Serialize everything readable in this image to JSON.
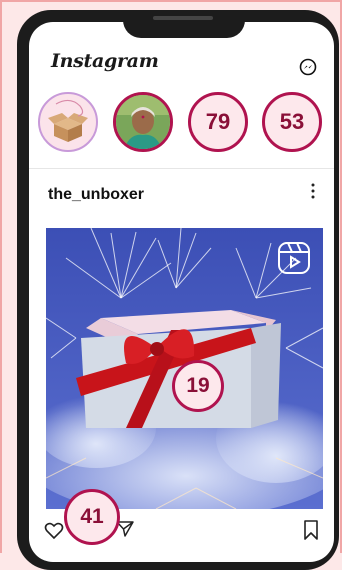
{
  "header": {
    "brand": "Instagram",
    "messenger_icon": "messenger-icon"
  },
  "stories": [
    {
      "type": "own",
      "icon": "box-icon"
    },
    {
      "type": "user",
      "icon": "user-photo"
    },
    {
      "type": "badge",
      "label": "79"
    },
    {
      "type": "badge",
      "label": "53"
    }
  ],
  "post": {
    "username": "the_unboxer",
    "more_icon": "more-vertical-icon",
    "reels_icon": "reels-icon",
    "center_badge": "19",
    "actions": {
      "like_icon": "heart-icon",
      "share_icon": "paper-plane-icon",
      "save_icon": "bookmark-icon",
      "like_badge": "41"
    }
  },
  "colors": {
    "background": "#fde8e8",
    "phone": "#1c1c1c",
    "badge_border": "#b0134f",
    "badge_text": "#8a1038",
    "post_sky": "#4a56b8"
  }
}
